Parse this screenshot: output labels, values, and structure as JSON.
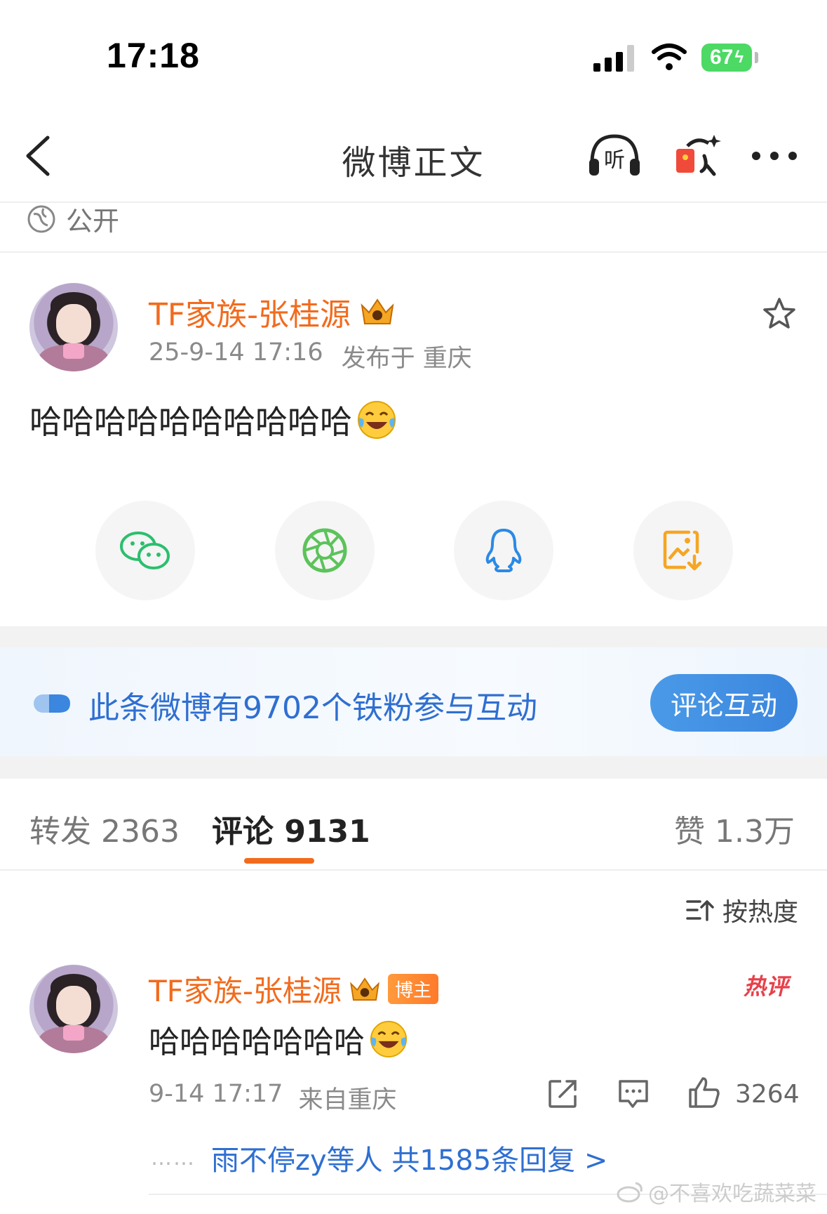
{
  "status_bar": {
    "time": "17:18",
    "battery": "67"
  },
  "header": {
    "title": "微博正文"
  },
  "post": {
    "visibility": "公开",
    "author": "TF家族-张桂源",
    "date": "25-9-14 17:16",
    "location": "发布于 重庆",
    "text": "哈哈哈哈哈哈哈哈哈哈"
  },
  "share": {
    "items": [
      "wechat-icon",
      "moments-icon",
      "qq-icon",
      "save-image-icon"
    ]
  },
  "fan_banner": {
    "text": "此条微博有9702个铁粉参与互动",
    "button": "评论互动"
  },
  "tabs": {
    "repost": "转发 2363",
    "comment": "评论 9131",
    "like": "赞 1.3万"
  },
  "sort": {
    "label": "按热度"
  },
  "comment": {
    "author": "TF家族-张桂源",
    "badge": "博主",
    "hot_label": "热评",
    "text": "哈哈哈哈哈哈哈",
    "time": "9-14 17:17",
    "location": "来自重庆",
    "likes": "3264",
    "replies_dots": "……",
    "replies": "雨不停zy等人  共1585条回复 >"
  },
  "watermark": "@不喜欢吃蔬菜菜",
  "colors": {
    "accent": "#f26b1d",
    "link": "#2f6fd1",
    "button": "#3b86de"
  }
}
